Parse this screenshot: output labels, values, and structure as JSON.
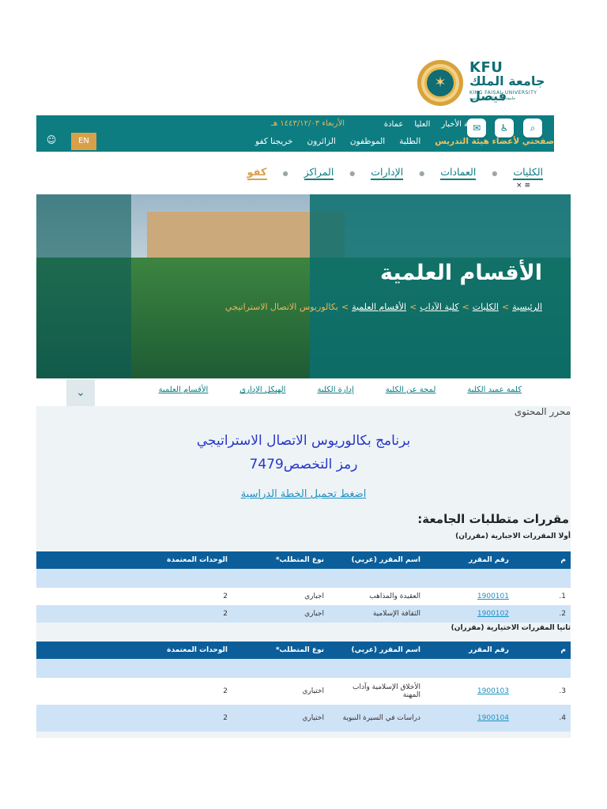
{
  "logo": {
    "abbr": "KFU",
    "arabic_name": "جامعة الملك فيصل",
    "english_name": "KING FAISAL UNIVERSITY",
    "arabic_tagline": "جامعة وطنية للتعليم والتنمية"
  },
  "topbar": {
    "row1": [
      "بوابة الأخبار",
      "العليا",
      "عمادة"
    ],
    "date": "الأربعاء ١٤٤٣/١٢/٠٣ هـ",
    "row2": [
      "صفحتي لأعضاء هيئة التدريس",
      "الطلبة",
      "الموظفون",
      "الزائرون",
      "خريجنا كفو"
    ],
    "lang_btn": "EN",
    "icons": {
      "search": "search-icon",
      "accessibility": "accessibility-icon",
      "mail": "mail-icon",
      "user": "user-icon"
    }
  },
  "mainnav": {
    "items": [
      "الكليات",
      "العمادات",
      "الإدارات",
      "المراكز"
    ],
    "gold": "كفو",
    "menu_close": "× ≡"
  },
  "hero": {
    "title": "الأقسام العلمية",
    "crumbs": [
      "الرئيسية",
      "الكليات",
      "كلية الآداب",
      "الأقسام العلمية"
    ],
    "current": "بكالوريوس الاتصال الاستراتيجي"
  },
  "subnav": {
    "items": [
      "كلمة عميد الكلية",
      "لمحة عن الكلية",
      "إدارة الكلية",
      "الهيكل الإداري",
      "الأقسام العلمية"
    ]
  },
  "content": {
    "editor": "محرر المحتوى",
    "program_title": "برنامج بكالوريوس الاتصال الاستراتيجي",
    "program_code": "رمز التخصص7479",
    "plan_link": "اضغط تحميل الخطة الدراسية",
    "requirements_heading": "مقررات متطلبات الجامعة:",
    "mandatory_heading": "أولا المقررات الاجبارية (مقرران)",
    "elective_heading": "ثانيا المقررات الاختيارية (مقرران)",
    "table_headers": [
      "م",
      "رقم المقرر",
      "اسم المقرر (عربي)",
      "نوع المتطلب*",
      "الوحدات المعتمدة"
    ],
    "mandatory_rows": [
      {
        "n": "1.",
        "code": "1900101",
        "name": "العقيدة والمذاهب",
        "type": "اجباري",
        "credits": "2"
      },
      {
        "n": "2.",
        "code": "1900102",
        "name": "الثقافة الإسلامية",
        "type": "اجباري",
        "credits": "2"
      }
    ],
    "elective_rows": [
      {
        "n": "3.",
        "code": "1900103",
        "name": "الأخلاق الإسلامية وآداب المهنة",
        "type": "اختياري",
        "credits": "2"
      },
      {
        "n": "4.",
        "code": "1900104",
        "name": "دراسات في السيرة النبوية",
        "type": "اختياري",
        "credits": "2"
      }
    ]
  }
}
